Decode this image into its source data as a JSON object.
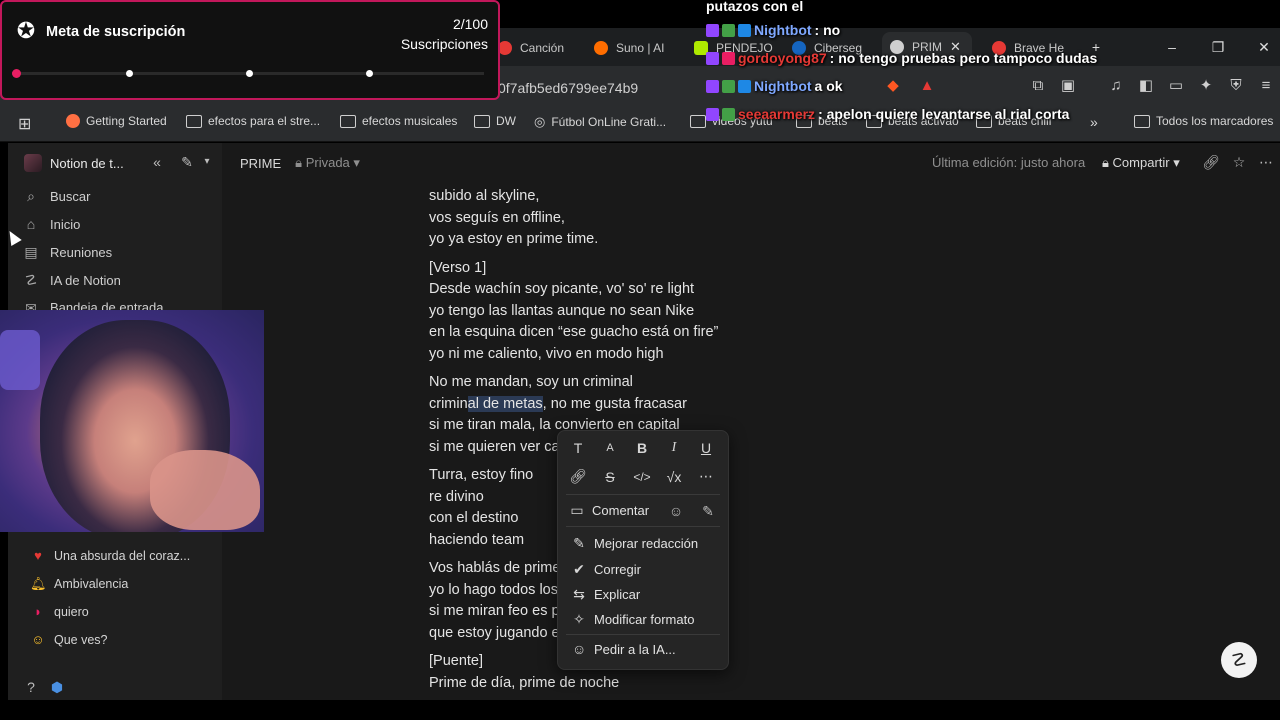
{
  "overlay": {
    "goal_title": "Meta de suscripción",
    "goal_count": "2/100",
    "goal_unit": "Suscripciones",
    "goal_progress": 0.02
  },
  "chat": [
    {
      "user": "",
      "text": "putazos con el",
      "user_color": "#ffffff"
    },
    {
      "user": "Nightbot",
      "text": ": no",
      "user_color": "#7fa8ff"
    },
    {
      "user": "gordoyong87",
      "text": ": no tengo pruebas pero tampoco dudas",
      "user_color": "#e53935"
    },
    {
      "user": "Nightbot",
      "text": "a ok",
      "user_color": "#7fa8ff"
    },
    {
      "user": "seeaarmerz",
      "text": ": apelon quiere levantarse al rial corta",
      "user_color": "#e53935"
    }
  ],
  "browser": {
    "tabs": [
      {
        "label": "Canción",
        "color": "#e53935"
      },
      {
        "label": "Suno | AI",
        "color": "#ff6d00"
      },
      {
        "label": "PENDEJO",
        "color": "#aeea00"
      },
      {
        "label": "Ciberseg",
        "color": "#1565c0"
      },
      {
        "label": "PRIM",
        "color": "#cfcfcf"
      },
      {
        "label": "Brave He",
        "color": "#e53935"
      }
    ],
    "url": "0f7afb5ed6799ee74b9",
    "bookmarks": [
      "Getting Started",
      "efectos para el stre...",
      "efectos musicales",
      "DW",
      "Fútbol OnLine Grati...",
      "videos yutu",
      "beats",
      "beats activao",
      "beats chill",
      "Todos los marcadores"
    ]
  },
  "sidebar": {
    "workspace": "Notion de t...",
    "items": [
      {
        "icon": "search-icon",
        "label": "Buscar"
      },
      {
        "icon": "home-icon",
        "label": "Inicio"
      },
      {
        "icon": "meeting-icon",
        "label": "Reuniones"
      },
      {
        "icon": "ai-icon",
        "label": "IA de Notion"
      },
      {
        "icon": "inbox-icon",
        "label": "Bandeja de entrada"
      }
    ],
    "pages": [
      {
        "emoji": "heart",
        "label": "Una absurda del coraz..."
      },
      {
        "emoji": "bell",
        "label": "Ambivalencia"
      },
      {
        "emoji": "lips",
        "label": "quiero"
      },
      {
        "emoji": "smiley",
        "label": "Que ves?"
      }
    ]
  },
  "page": {
    "title": "PRIME",
    "privacy": "Privada",
    "edited": "Última edición: justo ahora",
    "share": "Compartir",
    "lyrics": {
      "l1": "subido al skyline,",
      "l2": "vos seguís en offline,",
      "l3": "yo ya estoy en prime time.",
      "l4": "[Verso 1]",
      "l5": "Desde wachín soy picante, vo' so' re light",
      "l6": "yo tengo las llantas aunque no sean Nike",
      "l7": "en la esquina dicen “ese guacho está on fire”",
      "l8": "yo ni me caliento, vivo en modo high",
      "l9": "No me mandan, soy un criminal",
      "l10a": "crimin",
      "l10b": "al de metas",
      "l10c": ", no me gusta fracasar",
      "l11": "si me tiran mala, la convierto en capital",
      "l12": "si me quieren ver ca",
      "l13": "Turra, estoy fino",
      "l14": "re divino",
      "l15": "con el destino",
      "l16": "haciendo team",
      "l17": "Vos hablás de prime",
      "l18": "yo lo hago todos los",
      "l19": "si me miran feo es p",
      "l20": "que estoy jugando e",
      "l21": "[Puente]",
      "l22": "Prime de día, prime de noche"
    }
  },
  "popup": {
    "format_buttons": [
      "T",
      "A",
      "B",
      "I",
      "U"
    ],
    "comment": "Comentar",
    "actions": [
      "Mejorar redacción",
      "Corregir",
      "Explicar",
      "Modificar formato",
      "Pedir a la IA..."
    ]
  }
}
